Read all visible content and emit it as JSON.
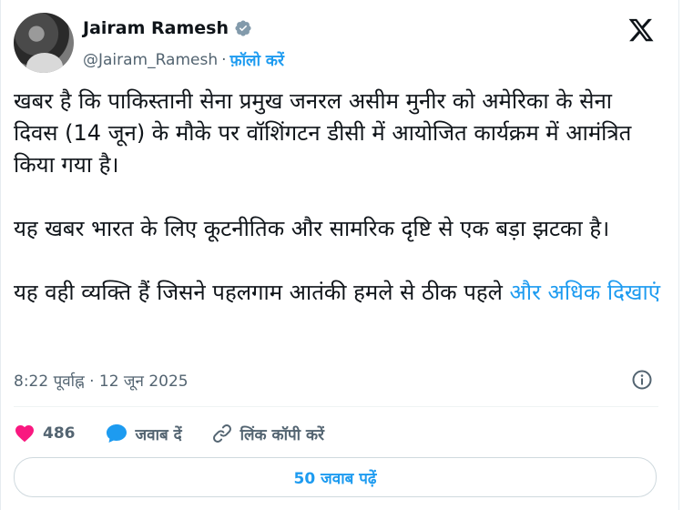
{
  "tweet": {
    "author_name": "Jairam Ramesh",
    "author_handle": "@Jairam_Ramesh",
    "separator": "·",
    "follow_label": "फ़ॉलो करें",
    "paragraphs": [
      "खबर है कि पाकिस्तानी सेना प्रमुख जनरल असीम मुनीर को अमेरिका के सेना दिवस (14 जून) के मौके पर वॉशिंगटन डीसी में आयोजित कार्यक्रम में आमंत्रित किया गया है।",
      "यह खबर भारत के लिए कूटनीतिक और सामरिक दृष्टि से एक बड़ा झटका है।",
      "यह वही व्यक्ति हैं जिसने पहलगाम आतंकी हमले से ठीक पहले"
    ],
    "show_more_label": "और अधिक दिखाएं",
    "timestamp": "8:22 पूर्वाह्न · 12 जून 2025"
  },
  "actions": {
    "like_count": "486",
    "reply_label": "जवाब दें",
    "copy_link_label": "लिंक कॉपी करें"
  },
  "read_replies_label": "50 जवाब पढ़ें",
  "icons": {
    "verified": "verified-badge-icon",
    "x_logo": "x-logo-icon",
    "info": "info-icon",
    "heart": "heart-icon",
    "reply": "reply-bubble-icon",
    "link": "link-icon"
  },
  "colors": {
    "accent": "#1d9bf0",
    "like": "#f91880",
    "text": "#0f1419",
    "muted": "#536471"
  }
}
